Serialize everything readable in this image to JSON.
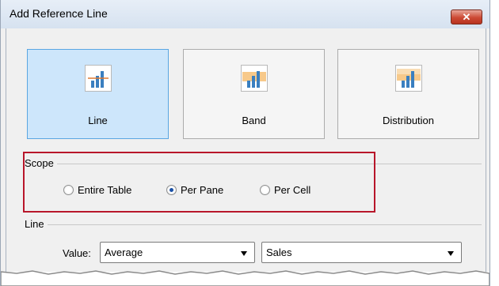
{
  "window": {
    "title": "Add Reference Line",
    "close_label": "✕"
  },
  "types": [
    {
      "label": "Line",
      "icon": "line-chart-icon",
      "selected": true
    },
    {
      "label": "Band",
      "icon": "band-chart-icon",
      "selected": false
    },
    {
      "label": "Distribution",
      "icon": "distribution-chart-icon",
      "selected": false
    }
  ],
  "scope": {
    "title": "Scope",
    "options": [
      {
        "label": "Entire Table",
        "checked": false
      },
      {
        "label": "Per Pane",
        "checked": true
      },
      {
        "label": "Per Cell",
        "checked": false
      }
    ]
  },
  "line": {
    "title": "Line",
    "value_label": "Value:",
    "aggregation": "Average",
    "field": "Sales"
  },
  "colors": {
    "accent": "#5aa6e2",
    "highlight": "#b8162a",
    "bar_blue": "#3a7fc0",
    "band_orange": "#f7c98a",
    "ref_line": "#e07a30"
  }
}
